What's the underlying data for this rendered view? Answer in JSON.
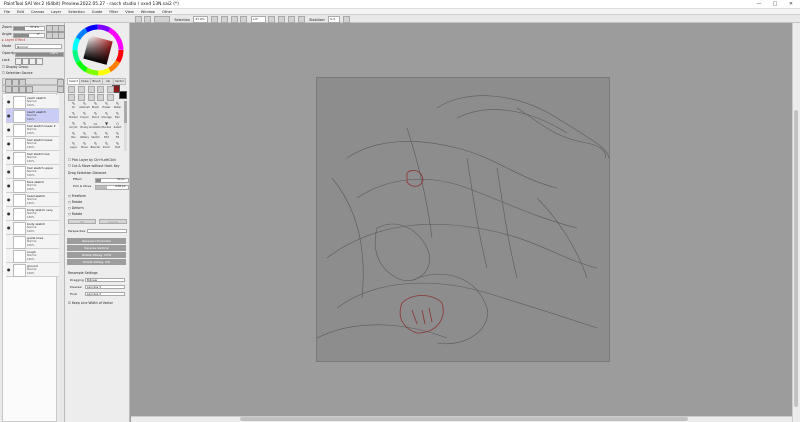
{
  "window": {
    "title": "PaintTool SAI Ver.2 (64bit) Preview.2022.05.27 - rasch studio / vxxd 13N.sai2 (*)",
    "minimize": "—",
    "maximize": "□",
    "close": "✕"
  },
  "menu": [
    "File",
    "Edit",
    "Canvas",
    "Layer",
    "Selection",
    "Guide",
    "Filter",
    "View",
    "Window",
    "Other"
  ],
  "toolbar": {
    "selection_label": "Selection",
    "zoom": "37.9%",
    "angle": "+0°",
    "stabilizer_label": "Stabilizer",
    "stabilizer_value": "S-3"
  },
  "left_panel": {
    "zoom_label": "Zoom",
    "zoom_value": "37.9%",
    "angle_label": "Angle",
    "angle_value": "0°",
    "layer_effect": "Layer Effect",
    "mode_label": "Mode",
    "mode_value": "Normal",
    "opacity_label": "Opacity",
    "opacity_value": "100%",
    "opacity_fill": 1.0,
    "lock_label": "Lock",
    "display_group": "Display Group",
    "selection_source": "Selection Source",
    "layers": [
      {
        "name": "rasch sketch",
        "mode": "Normal",
        "opacity": "100%",
        "selected": false
      },
      {
        "name": "rasch sketch",
        "mode": "Normal",
        "opacity": "100%",
        "selected": true
      },
      {
        "name": "hair sketch lower 2",
        "mode": "Normal",
        "opacity": "100%",
        "selected": false
      },
      {
        "name": "hair sketch lower",
        "mode": "Normal",
        "opacity": "100%",
        "selected": false
      },
      {
        "name": "hair sketch low",
        "mode": "Normal",
        "opacity": "100%",
        "selected": false
      },
      {
        "name": "hair sketch upper",
        "mode": "Normal",
        "opacity": "100%",
        "selected": false
      },
      {
        "name": "face sketch",
        "mode": "Normal",
        "opacity": "100%",
        "selected": false
      },
      {
        "name": "head sketch",
        "mode": "Normal",
        "opacity": "100%",
        "selected": false
      },
      {
        "name": "body sketch very",
        "mode": "Normal",
        "opacity": "100%",
        "selected": false
      },
      {
        "name": "body sketch",
        "mode": "Normal",
        "opacity": "100%",
        "selected": false
      },
      {
        "name": "guide lines",
        "mode": "Normal",
        "opacity": "100%",
        "selected": false
      },
      {
        "name": "rough",
        "mode": "Normal",
        "opacity": "100%",
        "selected": false
      },
      {
        "name": "ground",
        "mode": "Normal",
        "opacity": "100%",
        "selected": false
      }
    ]
  },
  "tool_panel": {
    "tabs": [
      "Select",
      "Draw",
      "Brush",
      "Ink",
      "Vector"
    ],
    "tools": [
      [
        "Air",
        "Airbrush",
        "Brush",
        "Eraser",
        "Water"
      ],
      [
        "Marker",
        "Crayon",
        "Pencil",
        "Smudge",
        "Blur"
      ],
      [
        "Acrylic",
        "Binary",
        "Gradation",
        "Bucket",
        "Select"
      ],
      [
        "Pen",
        "Watery",
        "Sketch",
        "Edit",
        "Fill"
      ],
      [
        "Layer",
        "Move",
        "Blender",
        "Zoom",
        "Text"
      ]
    ],
    "pick_layer": "Pick Layer by Ctrl+LeftClick",
    "cut_move": "Cut & Move without Hold. Key",
    "drag_threshold": "Drag Selection Distance",
    "effect_label": "Effect",
    "effect_value": "50 px",
    "pick_move_label": "Pick & Move",
    "pick_move_value": "4.00 px",
    "pick_move_fill": 0.35,
    "freeform": "Freeform",
    "rotate": "Rotate",
    "deform": "Deform",
    "scale": "Rotate",
    "ok_button": "OK",
    "cancel_button": "Cancel",
    "perspective_label": "Perspective",
    "reverse_horizontal": "Reverse Horizontal",
    "reverse_vertical": "Reverse Vertical",
    "rotate_cw": "Rotate 90deg. CCW",
    "rotate_ccw": "Rotate 90deg. CW",
    "resample_label": "Resample Settings",
    "dragging_label": "Dragging",
    "dragging_value": "Bilinear",
    "preview_label": "Preview",
    "preview_value": "Lanczos 3",
    "final_label": "Final",
    "final_value": "Lanczos 3",
    "keep_line_width": "Keep Line Width of Vector"
  },
  "colors": {
    "primary": "#8a1a1a",
    "secondary": "#000000",
    "canvas_bg": "#8d8d8d",
    "accent": "#c9ccf4"
  }
}
